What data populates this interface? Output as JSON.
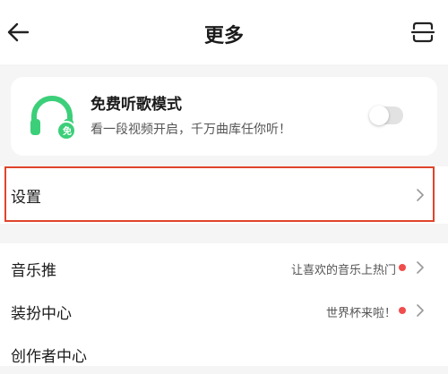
{
  "header": {
    "title": "更多",
    "back_icon": "arrow-left-icon",
    "scan_icon": "scan-icon"
  },
  "free_mode": {
    "title": "免费听歌模式",
    "subtitle": "看一段视频开启，千万曲库任你听！",
    "badge": "免",
    "icon": "headphone-icon",
    "enabled": false,
    "accent_color": "#3ccf79"
  },
  "settings": {
    "label": "设置"
  },
  "menu": [
    {
      "label": "音乐推",
      "hint": "让喜欢的音乐上热门",
      "has_dot": true
    },
    {
      "label": "装扮中心",
      "hint": "世界杯来啦！",
      "has_dot": true
    },
    {
      "label": "创作者中心",
      "hint": "",
      "has_dot": false
    }
  ],
  "colors": {
    "highlight": "#e0442a",
    "dot": "#f04d4d"
  }
}
